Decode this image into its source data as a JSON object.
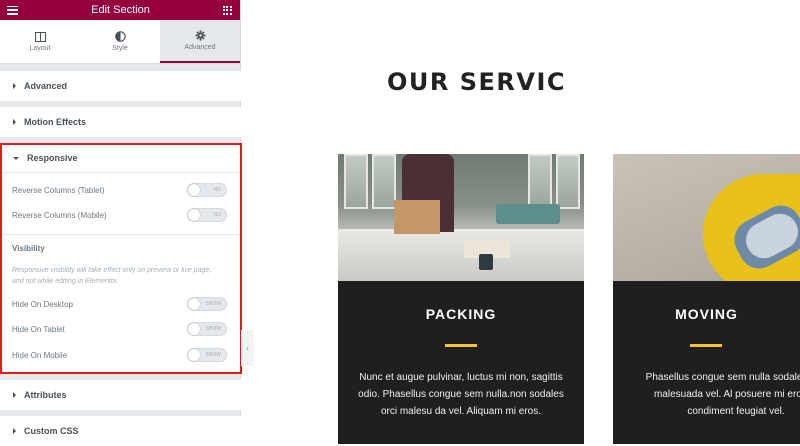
{
  "panel": {
    "title": "Edit Section",
    "tabs": [
      {
        "label": "Layout",
        "icon": "columns-icon"
      },
      {
        "label": "Style",
        "icon": "half-circle-icon"
      },
      {
        "label": "Advanced",
        "icon": "gear-icon",
        "active": true
      }
    ],
    "sections": {
      "advanced": "Advanced",
      "motion": "Motion Effects",
      "responsive": "Responsive",
      "attributes": "Attributes",
      "custom_css": "Custom CSS"
    },
    "responsive": {
      "reverse_tablet": {
        "label": "Reverse Columns (Tablet)",
        "state": "NO"
      },
      "reverse_mobile": {
        "label": "Reverse Columns (Mobile)",
        "state": "NO"
      },
      "visibility_title": "Visibility",
      "visibility_note": "Responsive visibility will take effect only on preview or live page, and not while editing in Elementor.",
      "hide_desktop": {
        "label": "Hide On Desktop",
        "state": "SHOW"
      },
      "hide_tablet": {
        "label": "Hide On Tablet",
        "state": "SHOW"
      },
      "hide_mobile": {
        "label": "Hide On Mobile",
        "state": "SHOW"
      }
    },
    "colors": {
      "brand": "#93003c",
      "highlight": "#e31b1b"
    }
  },
  "preview": {
    "heading": "OUR SERVIC",
    "cards": [
      {
        "title": "PACKING",
        "text": "Nunc et augue pulvinar, luctus mi non, sagittis odio. Phasellus congue sem nulla.non sodales orci malesu da vel. Aliquam mi eros."
      },
      {
        "title": "MOVING",
        "text": "Phasellus congue sem nulla sodales orci malesuada vel. Al posuere mi eros.at condiment feugiat vel."
      }
    ],
    "accent_color": "#f4c430"
  }
}
